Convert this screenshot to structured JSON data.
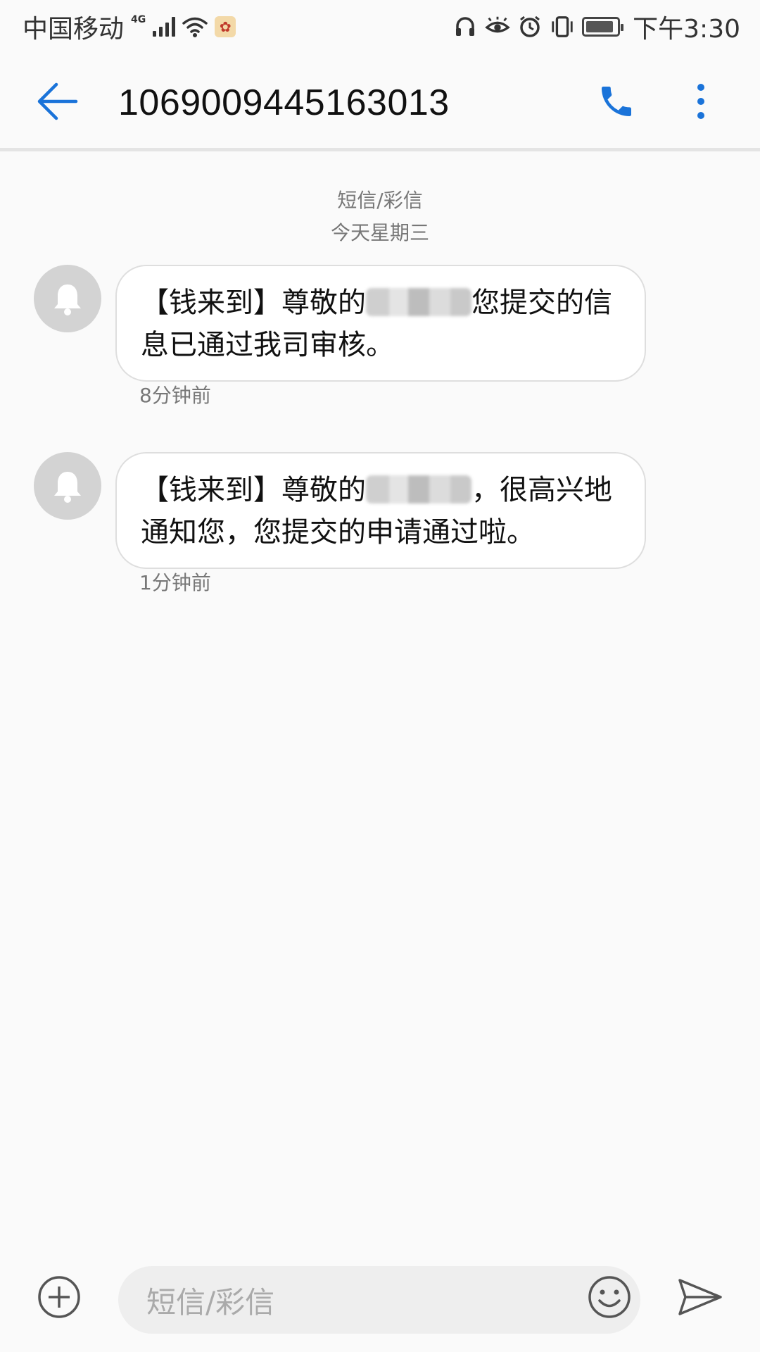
{
  "status_bar": {
    "carrier": "中国移动",
    "network": "4G",
    "time": "下午3:30",
    "battery_level": 0.9,
    "icons": [
      "signal-icon",
      "wifi-icon",
      "app-notification-icon",
      "headphones-icon",
      "eye-comfort-icon",
      "alarm-icon",
      "vibrate-icon",
      "battery-icon"
    ]
  },
  "app_bar": {
    "title": "1069009445163013",
    "back_icon": "back-arrow-icon",
    "call_icon": "phone-icon",
    "more_icon": "more-vert-icon"
  },
  "conversation": {
    "channel_label": "短信/彩信",
    "date_label": "今天星期三",
    "messages": [
      {
        "avatar_icon": "bell-icon",
        "text_before": "【钱来到】尊敬的",
        "text_after": "您提交的信息已通过我司审核。",
        "time": "8分钟前"
      },
      {
        "avatar_icon": "bell-icon",
        "text_before": "【钱来到】尊敬的",
        "text_after": "，很高兴地通知您，您提交的申请通过啦。",
        "time": "1分钟前"
      }
    ]
  },
  "composer": {
    "placeholder": "短信/彩信",
    "add_icon": "add-circle-icon",
    "emoji_icon": "emoji-icon",
    "send_icon": "send-icon"
  },
  "colors": {
    "accent": "#1a73d9",
    "background": "#fafafa",
    "bubble": "#ffffff",
    "avatar": "#d3d3d3"
  }
}
